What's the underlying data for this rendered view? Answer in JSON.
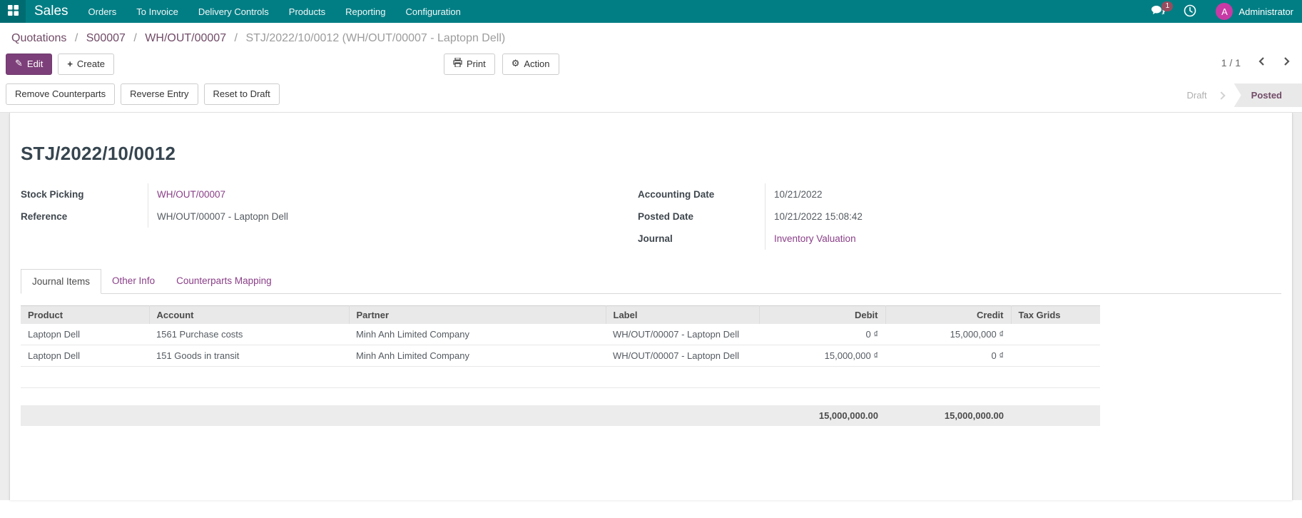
{
  "navbar": {
    "app_name": "Sales",
    "menu_items": [
      "Orders",
      "To Invoice",
      "Delivery Controls",
      "Products",
      "Reporting",
      "Configuration"
    ],
    "message_count": "1",
    "user": {
      "initial": "A",
      "name": "Administrator"
    }
  },
  "breadcrumb": {
    "links": [
      "Quotations",
      "S00007",
      "WH/OUT/00007"
    ],
    "separator": "/",
    "current": "STJ/2022/10/0012 (WH/OUT/00007 - Laptopn Dell)"
  },
  "control_panel": {
    "edit": "Edit",
    "create": "Create",
    "print": "Print",
    "action": "Action",
    "pager": "1 / 1"
  },
  "action_buttons": [
    "Remove Counterparts",
    "Reverse Entry",
    "Reset to Draft"
  ],
  "statusbar": {
    "draft": "Draft",
    "posted": "Posted"
  },
  "form": {
    "title": "STJ/2022/10/0012",
    "left_fields": [
      {
        "label": "Stock Picking",
        "value": "WH/OUT/00007"
      },
      {
        "label": "Reference",
        "value": "WH/OUT/00007 - Laptopn Dell"
      }
    ],
    "right_fields": [
      {
        "label": "Accounting Date",
        "value": "10/21/2022"
      },
      {
        "label": "Posted Date",
        "value": "10/21/2022 15:08:42"
      },
      {
        "label": "Journal",
        "value": "Inventory Valuation"
      }
    ],
    "tabs": [
      "Journal Items",
      "Other Info",
      "Counterparts Mapping"
    ]
  },
  "journal_items": {
    "columns": [
      "Product",
      "Account",
      "Partner",
      "Label",
      "Debit",
      "Credit",
      "Tax Grids"
    ],
    "rows": [
      {
        "product": "Laptopn Dell",
        "account": "1561 Purchase costs",
        "partner": "Minh Anh Limited Company",
        "label": "WH/OUT/00007 - Laptopn Dell",
        "debit": "0 ₫",
        "credit": "15,000,000 ₫",
        "tax_grids": ""
      },
      {
        "product": "Laptopn Dell",
        "account": "151 Goods in transit",
        "partner": "Minh Anh Limited Company",
        "label": "WH/OUT/00007 - Laptopn Dell",
        "debit": "15,000,000 ₫",
        "credit": "0 ₫",
        "tax_grids": ""
      }
    ],
    "totals": {
      "debit": "15,000,000.00",
      "credit": "15,000,000.00"
    }
  },
  "colors": {
    "navbar_bg": "#017e84",
    "primary_button": "#7d3f7a",
    "link_purple": "#8a3f88",
    "breadcrumb_link": "#714b67",
    "status_posted_text": "#714b67",
    "avatar_bg": "#c73aa5",
    "badge_bg": "#964d5f"
  }
}
